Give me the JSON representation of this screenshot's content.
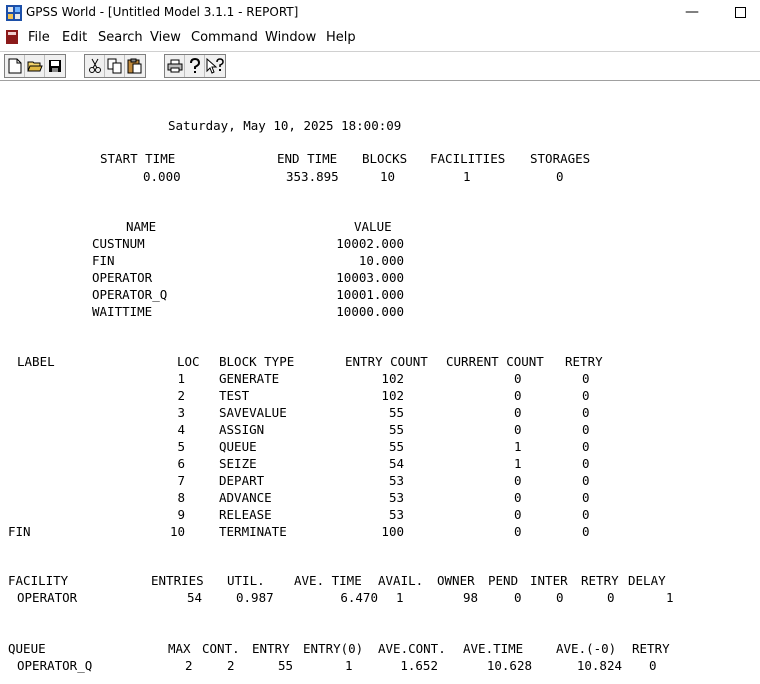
{
  "window": {
    "title": "GPSS World - [Untitled Model 3.1.1  -  REPORT]",
    "minimize": "—"
  },
  "menu": [
    "File",
    "Edit",
    "Search",
    "View",
    "Command",
    "Window",
    "Help"
  ],
  "toolbar": {
    "icons": [
      "new-icon",
      "open-icon",
      "save-icon",
      "cut-icon",
      "copy-icon",
      "paste-icon",
      "print-icon",
      "help-icon",
      "context-help-icon"
    ]
  },
  "report": {
    "date": "Saturday, May 10, 2025 18:00:09",
    "summary": {
      "headers": [
        "START TIME",
        "END TIME",
        "BLOCKS",
        "FACILITIES",
        "STORAGES"
      ],
      "values": [
        "0.000",
        "353.895",
        "10",
        "1",
        "0"
      ]
    },
    "names": {
      "headers": [
        "NAME",
        "VALUE"
      ],
      "rows": [
        [
          "CUSTNUM",
          "10002.000"
        ],
        [
          "FIN",
          "10.000"
        ],
        [
          "OPERATOR",
          "10003.000"
        ],
        [
          "OPERATOR_Q",
          "10001.000"
        ],
        [
          "WAITTIME",
          "10000.000"
        ]
      ]
    },
    "blocks": {
      "headers": [
        "LABEL",
        "LOC",
        "BLOCK TYPE",
        "ENTRY COUNT",
        "CURRENT COUNT",
        "RETRY"
      ],
      "rows": [
        [
          "",
          "1",
          "GENERATE",
          "102",
          "0",
          "0"
        ],
        [
          "",
          "2",
          "TEST",
          "102",
          "0",
          "0"
        ],
        [
          "",
          "3",
          "SAVEVALUE",
          "55",
          "0",
          "0"
        ],
        [
          "",
          "4",
          "ASSIGN",
          "55",
          "0",
          "0"
        ],
        [
          "",
          "5",
          "QUEUE",
          "55",
          "1",
          "0"
        ],
        [
          "",
          "6",
          "SEIZE",
          "54",
          "1",
          "0"
        ],
        [
          "",
          "7",
          "DEPART",
          "53",
          "0",
          "0"
        ],
        [
          "",
          "8",
          "ADVANCE",
          "53",
          "0",
          "0"
        ],
        [
          "",
          "9",
          "RELEASE",
          "53",
          "0",
          "0"
        ],
        [
          "FIN",
          "10",
          "TERMINATE",
          "100",
          "0",
          "0"
        ]
      ]
    },
    "facility": {
      "headers": [
        "FACILITY",
        "ENTRIES",
        "UTIL.",
        "AVE. TIME",
        "AVAIL.",
        "OWNER",
        "PEND",
        "INTER",
        "RETRY",
        "DELAY"
      ],
      "row": [
        "OPERATOR",
        "54",
        "0.987",
        "6.470",
        "1",
        "98",
        "0",
        "0",
        "0",
        "1"
      ]
    },
    "queue": {
      "headers": [
        "QUEUE",
        "MAX",
        "CONT.",
        "ENTRY",
        "ENTRY(0)",
        "AVE.CONT.",
        "AVE.TIME",
        "AVE.(-0)",
        "RETRY"
      ],
      "row": [
        "OPERATOR_Q",
        "2",
        "2",
        "55",
        "1",
        "1.652",
        "10.628",
        "10.824",
        "0"
      ]
    }
  }
}
